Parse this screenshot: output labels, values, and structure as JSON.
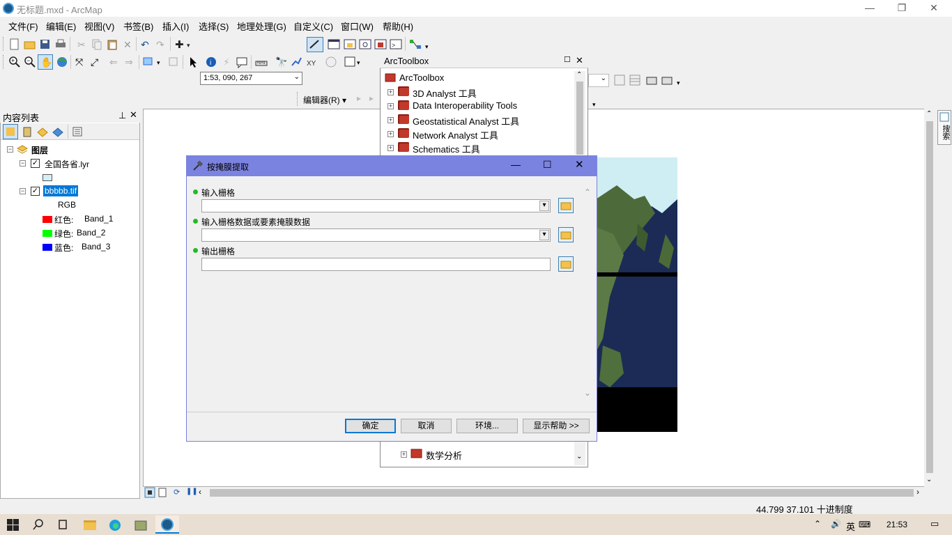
{
  "window": {
    "title": "无标题.mxd - ArcMap"
  },
  "menu": [
    "文件(F)",
    "编辑(E)",
    "视图(V)",
    "书签(B)",
    "插入(I)",
    "选择(S)",
    "地理处理(G)",
    "自定义(C)",
    "窗口(W)",
    "帮助(H)"
  ],
  "toolbar": {
    "scale": "1:53, 090, 267",
    "editor_label": "编辑器(R) ▾"
  },
  "toc": {
    "title": "内容列表",
    "root": "图层",
    "layers": [
      {
        "name": "全国各省.lyr"
      },
      {
        "name": "bbbbb.tif",
        "sublabel": "RGB"
      }
    ],
    "bands": [
      {
        "color_label": "红色:",
        "band": "Band_1",
        "color": "#ff0000"
      },
      {
        "color_label": "绿色:",
        "band": "Band_2",
        "color": "#00ff00"
      },
      {
        "color_label": "蓝色:",
        "band": "Band_3",
        "color": "#0000ff"
      }
    ]
  },
  "toolbox": {
    "title": "ArcToolbox",
    "root": "ArcToolbox",
    "items": [
      "3D Analyst 工具",
      "Data Interoperability Tools",
      "Geostatistical Analyst 工具",
      "Network Analyst 工具",
      "Schematics 工具"
    ],
    "bottom_items": [
      "数学分析"
    ]
  },
  "dialog": {
    "title": "按掩膜提取",
    "fields": [
      {
        "label": "输入栅格",
        "value": ""
      },
      {
        "label": "输入栅格数据或要素掩膜数据",
        "value": ""
      },
      {
        "label": "输出栅格",
        "value": ""
      }
    ],
    "buttons": {
      "ok": "确定",
      "cancel": "取消",
      "env": "环境...",
      "help": "显示帮助 >>"
    }
  },
  "right_tab": "搜索",
  "status": {
    "coords": "44.799  37.101 十进制度"
  },
  "taskbar": {
    "ime": "英",
    "time": "21:53"
  }
}
